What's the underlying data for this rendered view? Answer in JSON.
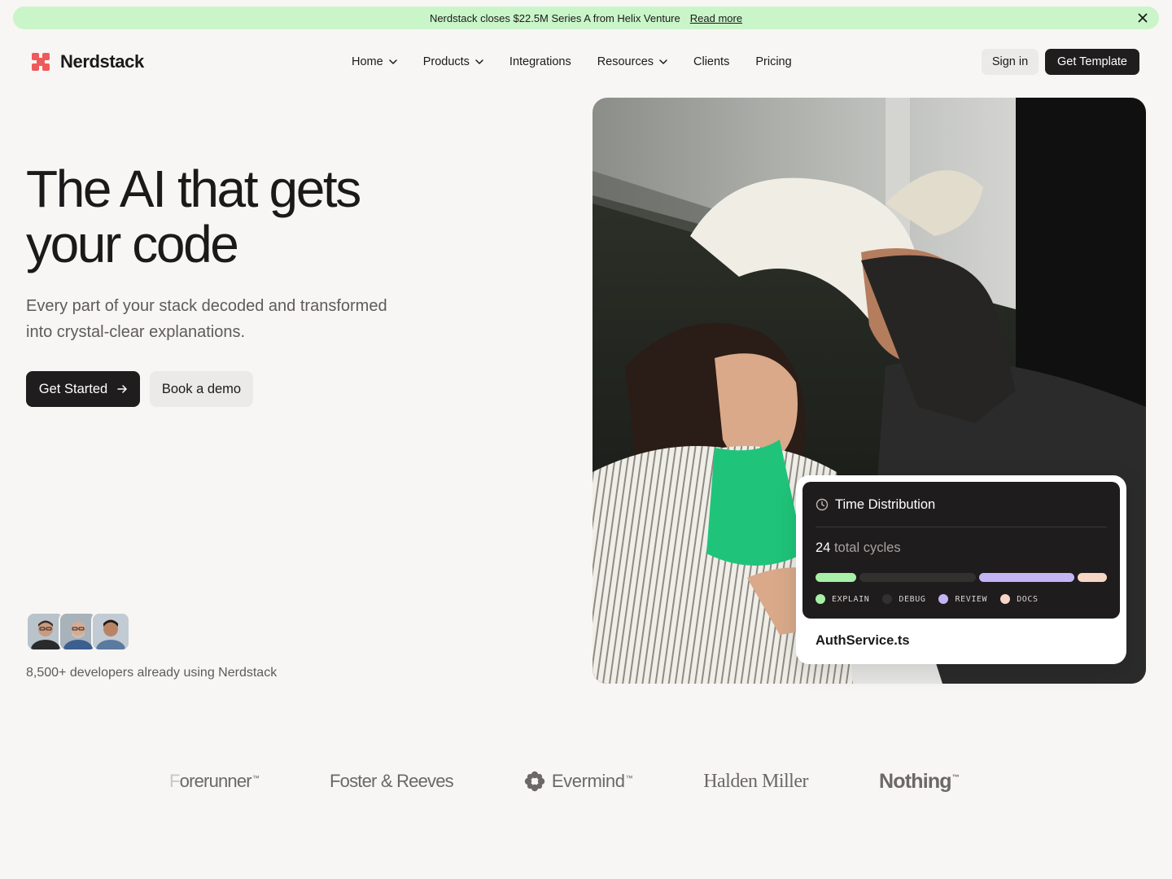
{
  "banner": {
    "text": "Nerdstack closes $22.5M Series A from Helix Venture",
    "link_label": "Read more"
  },
  "brand": {
    "name": "Nerdstack",
    "accent_color": "#ef5a5a"
  },
  "nav": {
    "items": [
      {
        "label": "Home",
        "has_dropdown": true
      },
      {
        "label": "Products",
        "has_dropdown": true
      },
      {
        "label": "Integrations",
        "has_dropdown": false
      },
      {
        "label": "Resources",
        "has_dropdown": true
      },
      {
        "label": "Clients",
        "has_dropdown": false
      },
      {
        "label": "Pricing",
        "has_dropdown": false
      }
    ],
    "signin_label": "Sign in",
    "cta_label": "Get Template"
  },
  "hero": {
    "title_line1": "The AI that gets",
    "title_line2": "your code",
    "subtitle": "Every part of your stack decoded and transformed into crystal-clear explanations.",
    "primary_cta": "Get Started",
    "secondary_cta": "Book a demo",
    "social_proof": "8,500+ developers already using Nerdstack"
  },
  "card": {
    "title": "Time Distribution",
    "cycles_count": "24",
    "cycles_label": "total cycles",
    "segments": [
      {
        "label": "EXPLAIN",
        "color": "#a8f0a8",
        "share": 0.14
      },
      {
        "label": "DEBUG",
        "color": "#333030",
        "share": 0.4
      },
      {
        "label": "REVIEW",
        "color": "#c3b4f5",
        "share": 0.33
      },
      {
        "label": "DOCS",
        "color": "#f8d6c6",
        "share": 0.1
      }
    ],
    "file_name": "AuthService.ts"
  },
  "clients": {
    "forerunner_faded": "F",
    "forerunner_rest": "orerunner",
    "foster": "Foster & Reeves",
    "evermind": "Evermind",
    "halden": "Halden Miller",
    "nothing": "Nothing",
    "tm": "™"
  }
}
